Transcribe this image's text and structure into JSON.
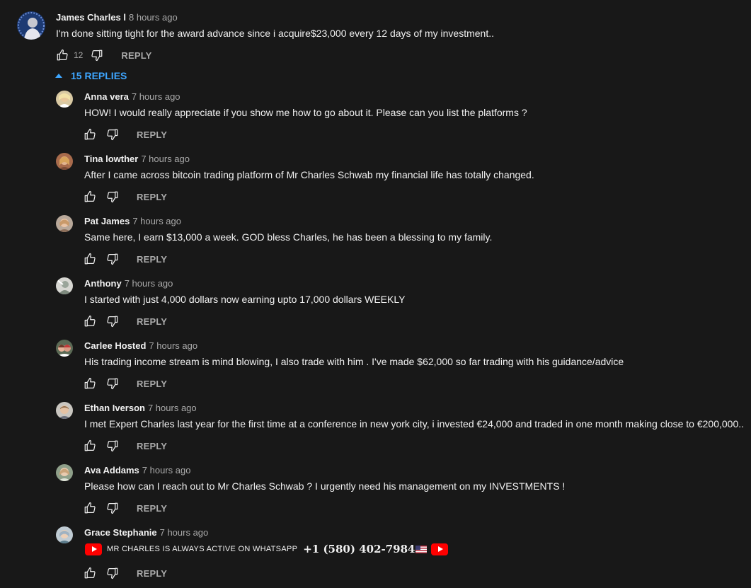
{
  "top_comment": {
    "author": "James Charles l",
    "time": "8 hours ago",
    "text": "I'm done sitting tight for the award advance since i acquire$23,000 every 12 days of my investment..",
    "likes": "12",
    "reply_label": "REPLY"
  },
  "replies_toggle": {
    "label": "15 REPLIES"
  },
  "replies": [
    {
      "author": "Anna vera",
      "time": "7 hours ago",
      "text": "HOW! I would really appreciate if you show me how to go about it. Please can you list the platforms ?",
      "reply_label": "REPLY"
    },
    {
      "author": "Tina lowther",
      "time": "7 hours ago",
      "text": "After I came across bitcoin trading platform of  Mr Charles Schwab my financial life has totally changed.",
      "reply_label": "REPLY"
    },
    {
      "author": "Pat James",
      "time": "7 hours ago",
      "text": "Same here, I earn $13,000 a week. GOD bless Charles, he has been a blessing to my family.",
      "reply_label": "REPLY"
    },
    {
      "author": "Anthony",
      "time": "7 hours ago",
      "text": "I started with just 4,000 dollars now earning upto 17,000 dollars  WEEKLY",
      "reply_label": "REPLY"
    },
    {
      "author": "Carlee Hosted",
      "time": "7 hours ago",
      "text": "His trading income stream is mind blowing, I also trade with him . I've made $62,000 so far trading with his guidance/advice",
      "reply_label": "REPLY"
    },
    {
      "author": "Ethan Iverson",
      "time": "7 hours ago",
      "text": "I met Expert  Charles  last year for the first time at a conference in new york city, i invested €24,000 and traded in one month making close to €200,000..",
      "reply_label": "REPLY"
    },
    {
      "author": "Ava Addams",
      "time": "7 hours ago",
      "text": "Please how can I reach out to Mr Charles Schwab ? I urgently need his management on my INVESTMENTS !",
      "reply_label": "REPLY"
    }
  ],
  "last_reply": {
    "author": "Grace Stephanie",
    "time": "7 hours ago",
    "text_part1": "MR CHARLES IS ALWAYS ACTIVE ON WHATSAPP",
    "text_part2": "+1 (580) 402-7984",
    "reply_label": "REPLY"
  },
  "colors": {
    "background": "#181818",
    "text": "#f1f1f1",
    "secondary": "#aaaaaa",
    "link": "#3ea6ff",
    "youtube_red": "#ff0000"
  },
  "icons": [
    "thumbs-up-icon",
    "thumbs-down-icon",
    "caret-up-icon",
    "youtube-logo-icon",
    "us-flag-icon"
  ]
}
